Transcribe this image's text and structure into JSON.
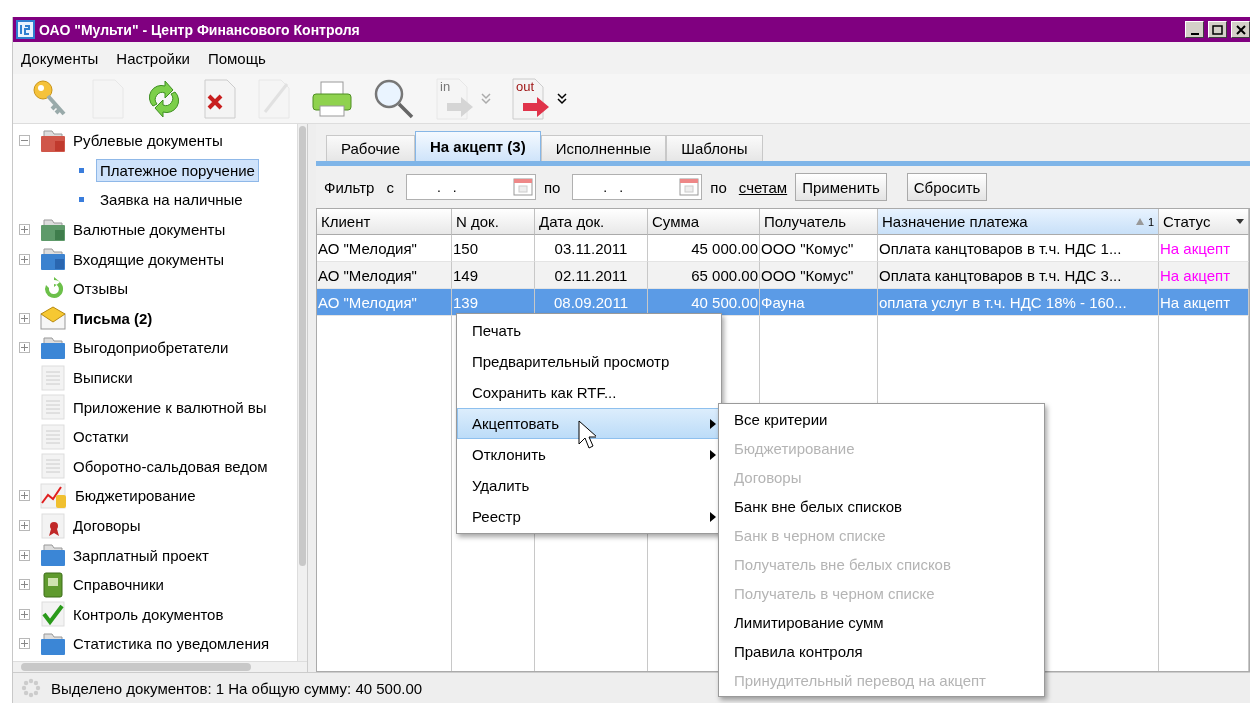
{
  "window": {
    "title": "ОАО \"Мульти\" - Центр Финансового Контроля"
  },
  "menu_bar": [
    "Документы",
    "Настройки",
    "Помощь"
  ],
  "toolbar": [
    {
      "kind": "key",
      "disabled": false
    },
    {
      "kind": "new",
      "disabled": true
    },
    {
      "kind": "refresh",
      "disabled": false
    },
    {
      "kind": "delete",
      "disabled": false
    },
    {
      "kind": "edit",
      "disabled": true
    },
    {
      "kind": "print",
      "disabled": false
    },
    {
      "kind": "search",
      "disabled": false
    },
    {
      "kind": "import",
      "disabled": true,
      "label": "in",
      "dropdown": true
    },
    {
      "kind": "export",
      "disabled": false,
      "label": "out",
      "dropdown": true
    }
  ],
  "sidebar": {
    "items": [
      {
        "kind": "folder-ruble",
        "label": "Рублевые документы",
        "expanded": true,
        "unread": false,
        "children": [
          {
            "label": "Платежное поручение",
            "selected": true
          },
          {
            "label": "Заявка на наличные",
            "selected": false
          }
        ]
      },
      {
        "kind": "folder-currency",
        "label": "Валютные документы",
        "expanded": false,
        "unread": false
      },
      {
        "kind": "folder-in",
        "label": "Входящие документы",
        "expanded": false,
        "unread": false
      },
      {
        "kind": "refresh",
        "label": "Отзывы",
        "unread": false
      },
      {
        "kind": "mail",
        "label": "Письма (2)",
        "expanded": false,
        "unread": true
      },
      {
        "kind": "folder",
        "label": "Выгодоприобретатели",
        "expanded": false,
        "unread": false
      },
      {
        "kind": "doc",
        "label": "Выписки",
        "unread": false
      },
      {
        "kind": "doc",
        "label": "Приложение к валютной вы",
        "unread": false
      },
      {
        "kind": "doc",
        "label": "Остатки",
        "unread": false
      },
      {
        "kind": "doc",
        "label": "Оборотно-сальдовая ведом",
        "unread": false
      },
      {
        "kind": "chart",
        "label": "Бюджетирование",
        "expanded": false,
        "unread": false
      },
      {
        "kind": "contract",
        "label": "Договоры",
        "expanded": false,
        "unread": false
      },
      {
        "kind": "folder",
        "label": "Зарплатный проект",
        "expanded": false,
        "unread": false
      },
      {
        "kind": "book",
        "label": "Справочники",
        "expanded": false,
        "unread": false
      },
      {
        "kind": "check",
        "label": "Контроль документов",
        "expanded": false,
        "unread": false
      },
      {
        "kind": "folder",
        "label": "Статистика по уведомления",
        "expanded": false,
        "unread": false
      }
    ]
  },
  "tabs": [
    {
      "label": "Рабочие",
      "selected": false
    },
    {
      "label": "На акцепт (3)",
      "selected": true
    },
    {
      "label": "Исполненные",
      "selected": false
    },
    {
      "label": "Шаблоны",
      "selected": false
    }
  ],
  "filter": {
    "label": "Фильтр",
    "from_label": "с",
    "from_value": ".  .",
    "to_label": "по",
    "to_value": ".  .",
    "accounts_label": "по",
    "accounts_link": "счетам",
    "apply": "Применить",
    "reset": "Сбросить"
  },
  "table": {
    "columns": [
      {
        "label": "Клиент"
      },
      {
        "label": "N док."
      },
      {
        "label": "Дата док."
      },
      {
        "label": "Сумма"
      },
      {
        "label": "Получатель"
      },
      {
        "label": "Назначение платежа",
        "sorted": true,
        "sort_order": "1"
      },
      {
        "label": "Статус",
        "menu": true
      }
    ],
    "rows": [
      {
        "selected": false,
        "cells": [
          "АО \"Мелодия\"",
          "150",
          "03.11.2011",
          "45 000.00",
          "ООО \"Комус\"",
          "Оплата канцтоваров в т.ч. НДС 1...",
          "На акцепт"
        ]
      },
      {
        "selected": false,
        "cells": [
          "АО \"Мелодия\"",
          "149",
          "02.11.2011",
          "65 000.00",
          "ООО \"Комус\"",
          "Оплата канцтоваров в т.ч. НДС 3...",
          "На акцепт"
        ]
      },
      {
        "selected": true,
        "cells": [
          "АО \"Мелодия\"",
          "139",
          "08.09.2011",
          "40 500.00",
          "Фауна",
          "оплата услуг в т.ч. НДС 18% - 160...",
          "На акцепт"
        ]
      }
    ]
  },
  "context_menu": {
    "items": [
      {
        "label": "Печать",
        "selected": false,
        "submenu": false
      },
      {
        "label": "Предварительный просмотр",
        "selected": false,
        "submenu": false
      },
      {
        "label": "Сохранить как RTF...",
        "selected": false,
        "submenu": false
      },
      {
        "label": "Акцептовать",
        "selected": true,
        "submenu": true
      },
      {
        "label": "Отклонить",
        "selected": false,
        "submenu": true
      },
      {
        "label": "Удалить",
        "selected": false,
        "submenu": false
      },
      {
        "label": "Реестр",
        "selected": false,
        "submenu": true
      }
    ],
    "submenu": [
      {
        "label": "Все критерии",
        "disabled": false
      },
      {
        "label": "Бюджетирование",
        "disabled": true
      },
      {
        "label": "Договоры",
        "disabled": true
      },
      {
        "label": "Банк вне белых списков",
        "disabled": false
      },
      {
        "label": "Банк в черном списке",
        "disabled": true
      },
      {
        "label": "Получатель вне белых списков",
        "disabled": true
      },
      {
        "label": "Получатель в черном списке",
        "disabled": true
      },
      {
        "label": "Лимитирование сумм",
        "disabled": false
      },
      {
        "label": "Правила контроля",
        "disabled": false
      },
      {
        "label": "Принудительный перевод на акцепт",
        "disabled": true
      }
    ]
  },
  "status_bar": "Выделено документов: 1 На общую сумму: 40 500.00"
}
